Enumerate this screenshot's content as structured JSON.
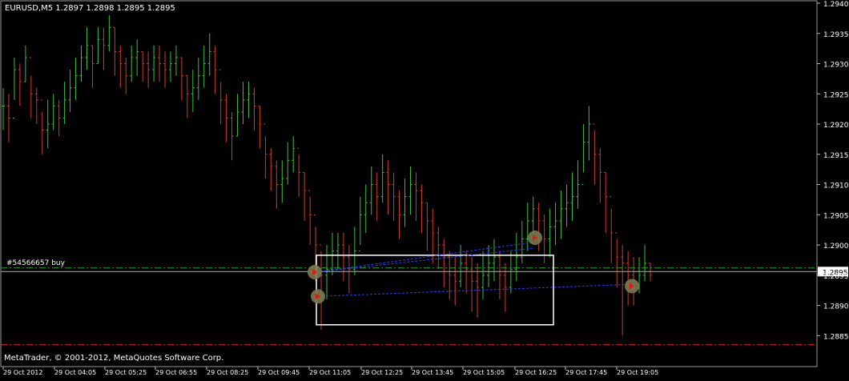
{
  "chart_data": {
    "type": "bar",
    "header": "EURUSD,M5  1.2897 1.2898 1.2895 1.2895",
    "copyright": "MetaTrader, © 2001-2012, MetaQuotes Software Corp.",
    "order_label": "#54566657 buy",
    "current_price_label": "1.2895",
    "ylim": [
      1.2882,
      1.294
    ],
    "y_ticks": [
      "1.2940",
      "1.2935",
      "1.2930",
      "1.2925",
      "1.2920",
      "1.2915",
      "1.2910",
      "1.2905",
      "1.2900",
      "1.2895",
      "1.2890",
      "1.2885"
    ],
    "x_ticks": [
      "29 Oct 2012",
      "29 Oct 04:05",
      "29 Oct 05:25",
      "29 Oct 06:55",
      "29 Oct 08:25",
      "29 Oct 09:45",
      "29 Oct 11:05",
      "29 Oct 12:25",
      "29 Oct 13:45",
      "29 Oct 15:05",
      "29 Oct 16:25",
      "29 Oct 17:45",
      "29 Oct 19:05"
    ],
    "levels": {
      "order_level": 1.28962,
      "bid_line": 1.28956,
      "stop_loss": 1.28835
    },
    "colors": {
      "background": "#000000",
      "text": "#ffffff",
      "up_bar": "#35c435",
      "down_bar": "#d63a2a",
      "order_line": "#1fae1f",
      "stop_line": "#e01a1a",
      "trade_line": "#2b3cff",
      "selection_box": "#ffffff",
      "bid_line": "#b0b0b0"
    },
    "series": [
      {
        "values": [
          1.2923,
          1.2921,
          1.2929,
          1.2927,
          1.2931,
          1.2925,
          1.2924,
          1.2919,
          1.292,
          1.2923,
          1.2921,
          1.2924,
          1.2926,
          1.2928,
          1.2931,
          1.2933,
          1.293,
          1.2934,
          1.2933,
          1.2936,
          1.2932,
          1.293,
          1.2928,
          1.2931,
          1.2932,
          1.293,
          1.2929,
          1.2931,
          1.293,
          1.2929,
          1.293,
          1.2931,
          1.2928,
          1.2925,
          1.2926,
          1.2928,
          1.293,
          1.2932,
          1.2929,
          1.2924,
          1.2921,
          1.2918,
          1.2922,
          1.2924,
          1.2925,
          1.2923,
          1.292,
          1.2915,
          1.2913,
          1.291,
          1.2911,
          1.2914,
          1.2916,
          1.2912,
          1.2909,
          1.2905,
          1.29,
          1.2895,
          1.2896,
          1.2899,
          1.29,
          1.2898,
          1.2896,
          1.2899,
          1.2905,
          1.2907,
          1.291,
          1.2908,
          1.2912,
          1.291,
          1.2908,
          1.2905,
          1.2908,
          1.291,
          1.2909,
          1.2907,
          1.2904,
          1.2902,
          1.29,
          1.2898,
          1.2895,
          1.2894,
          1.2897,
          1.2896,
          1.2894,
          1.2893,
          1.2895,
          1.2897,
          1.2898,
          1.2895,
          1.2893,
          1.2896,
          1.2898,
          1.2901,
          1.2904,
          1.2906,
          1.2904,
          1.2901,
          1.2903,
          1.2904,
          1.2906,
          1.2907,
          1.2908,
          1.291,
          1.2917,
          1.292,
          1.2915,
          1.2912,
          1.2908,
          1.2902,
          1.2898,
          1.2897,
          1.2895,
          1.2893,
          1.2895,
          1.2897,
          1.2895
        ],
        "highs": [
          1.2926,
          1.2925,
          1.2931,
          1.293,
          1.2933,
          1.2928,
          1.2926,
          1.2922,
          1.2924,
          1.2925,
          1.2924,
          1.2927,
          1.2929,
          1.2931,
          1.2933,
          1.2936,
          1.2933,
          1.2936,
          1.2936,
          1.2938,
          1.2936,
          1.2933,
          1.2931,
          1.2933,
          1.2934,
          1.2932,
          1.2932,
          1.2933,
          1.2933,
          1.2932,
          1.2932,
          1.2933,
          1.2931,
          1.2928,
          1.2929,
          1.2931,
          1.2933,
          1.2935,
          1.2933,
          1.2927,
          1.2925,
          1.2922,
          1.2925,
          1.2927,
          1.2927,
          1.2926,
          1.2923,
          1.2918,
          1.2916,
          1.2914,
          1.2914,
          1.2917,
          1.2918,
          1.2915,
          1.2912,
          1.2908,
          1.2903,
          1.2899,
          1.29,
          1.2902,
          1.2902,
          1.2902,
          1.29,
          1.2903,
          1.2908,
          1.291,
          1.2913,
          1.2912,
          1.2915,
          1.2914,
          1.2912,
          1.2909,
          1.2911,
          1.2913,
          1.2912,
          1.291,
          1.2907,
          1.2906,
          1.2903,
          1.2901,
          1.2899,
          1.2898,
          1.29,
          1.2899,
          1.2898,
          1.2897,
          1.2899,
          1.29,
          1.2901,
          1.2899,
          1.2897,
          1.2899,
          1.2902,
          1.2904,
          1.2907,
          1.2908,
          1.2907,
          1.2905,
          1.2906,
          1.2907,
          1.2909,
          1.291,
          1.2912,
          1.2914,
          1.292,
          1.2923,
          1.2919,
          1.2916,
          1.2912,
          1.2906,
          1.2901,
          1.29,
          1.2899,
          1.2898,
          1.2898,
          1.29,
          1.2897
        ],
        "lows": [
          1.2919,
          1.2917,
          1.2924,
          1.2923,
          1.2927,
          1.2921,
          1.292,
          1.2915,
          1.2916,
          1.2919,
          1.2918,
          1.292,
          1.2922,
          1.2924,
          1.2927,
          1.2929,
          1.2926,
          1.293,
          1.2929,
          1.2932,
          1.2928,
          1.2926,
          1.2925,
          1.2927,
          1.2928,
          1.2927,
          1.2926,
          1.2927,
          1.2927,
          1.2926,
          1.2927,
          1.2928,
          1.2924,
          1.2921,
          1.2922,
          1.2924,
          1.2926,
          1.2928,
          1.2925,
          1.292,
          1.2917,
          1.2914,
          1.2918,
          1.292,
          1.2921,
          1.2919,
          1.2916,
          1.2911,
          1.2909,
          1.2906,
          1.2907,
          1.291,
          1.2912,
          1.2908,
          1.2904,
          1.29,
          1.2894,
          1.2886,
          1.2891,
          1.2895,
          1.2896,
          1.2894,
          1.2892,
          1.2895,
          1.29,
          1.2902,
          1.2905,
          1.2904,
          1.2907,
          1.2905,
          1.2904,
          1.2901,
          1.2903,
          1.2905,
          1.2904,
          1.2902,
          1.2899,
          1.2897,
          1.2896,
          1.2893,
          1.2891,
          1.289,
          1.2893,
          1.2892,
          1.2889,
          1.2888,
          1.2891,
          1.2893,
          1.2894,
          1.2891,
          1.2889,
          1.2892,
          1.2894,
          1.2897,
          1.2899,
          1.2901,
          1.2899,
          1.2897,
          1.2898,
          1.29,
          1.2901,
          1.2903,
          1.2904,
          1.2906,
          1.2912,
          1.2914,
          1.291,
          1.2907,
          1.2902,
          1.2897,
          1.2893,
          1.2885,
          1.289,
          1.289,
          1.2892,
          1.2894,
          1.2894
        ]
      }
    ]
  },
  "toolbar": {}
}
